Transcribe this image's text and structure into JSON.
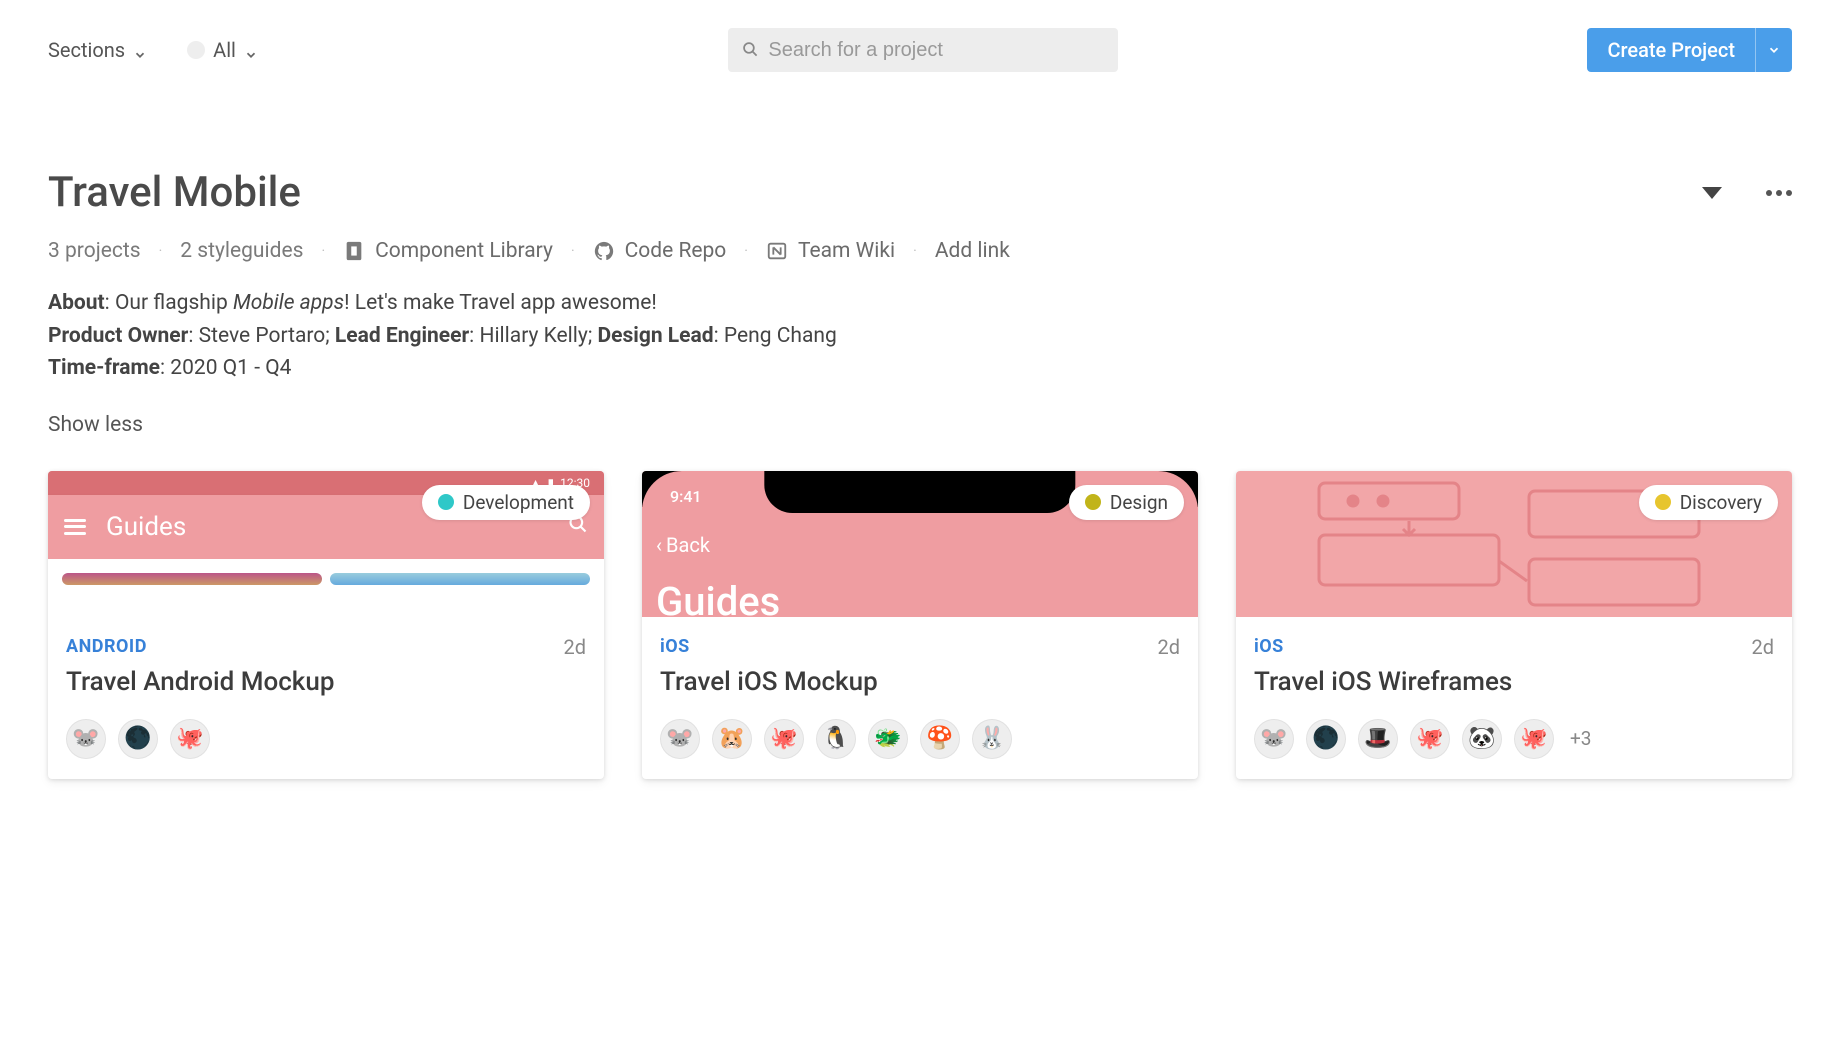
{
  "topbar": {
    "sections_label": "Sections",
    "filter_label": "All",
    "search_placeholder": "Search for a project",
    "create_label": "Create Project"
  },
  "header": {
    "title": "Travel Mobile",
    "projects_count": "3 projects",
    "styleguides_count": "2 styleguides",
    "links": [
      {
        "label": "Component Library",
        "icon": "storybook"
      },
      {
        "label": "Code Repo",
        "icon": "github"
      },
      {
        "label": "Team Wiki",
        "icon": "notion"
      }
    ],
    "add_link_label": "Add link",
    "about_label": "About",
    "about_text_prefix": ": Our flagship ",
    "about_text_italic": "Mobile apps",
    "about_text_suffix": "! Let's make Travel app awesome!",
    "product_owner_label": "Product Owner",
    "product_owner_value": ": Steve Portaro; ",
    "lead_engineer_label": "Lead Engineer",
    "lead_engineer_value": ": Hillary Kelly; ",
    "design_lead_label": "Design Lead",
    "design_lead_value": ": Peng Chang",
    "timeframe_label": "Time-frame",
    "timeframe_value": ": 2020 Q1 - Q4",
    "show_less": "Show less"
  },
  "preview_text": {
    "android_guides": "Guides",
    "android_time": "12:30",
    "ios_clock": "9:41",
    "ios_back": "Back",
    "ios_guides": "Guides"
  },
  "cards": [
    {
      "badge": {
        "label": "Development",
        "color": "#2fc8c8"
      },
      "platform": "ANDROID",
      "time": "2d",
      "title": "Travel Android Mockup",
      "avatars": [
        "🐭",
        "🌑",
        "🐙"
      ],
      "avatar_more": ""
    },
    {
      "badge": {
        "label": "Design",
        "color": "#c1b41a"
      },
      "platform": "iOS",
      "time": "2d",
      "title": "Travel iOS Mockup",
      "avatars": [
        "🐭",
        "🐹",
        "🐙",
        "🐧",
        "🐲",
        "🍄",
        "🐰"
      ],
      "avatar_more": ""
    },
    {
      "badge": {
        "label": "Discovery",
        "color": "#e7c52e"
      },
      "platform": "iOS",
      "time": "2d",
      "title": "Travel iOS Wireframes",
      "avatars": [
        "🐭",
        "🌑",
        "🎩",
        "🐙",
        "🐼",
        "🐙"
      ],
      "avatar_more": "+3"
    }
  ]
}
